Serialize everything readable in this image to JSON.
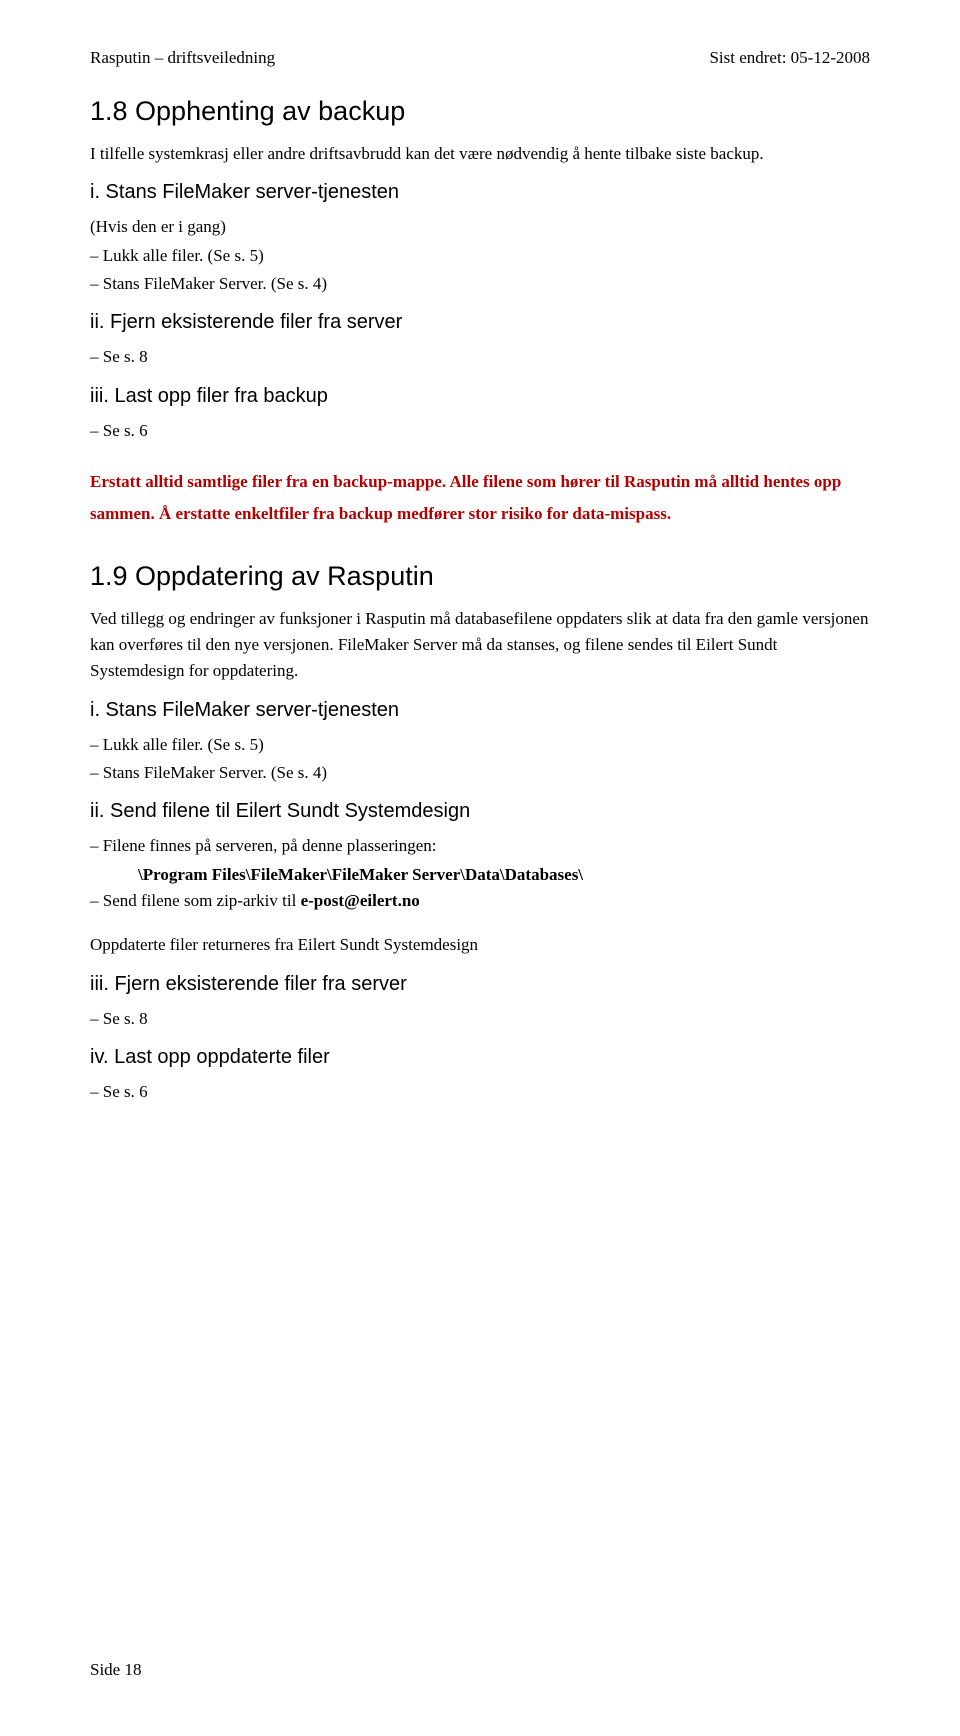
{
  "header": {
    "left": "Rasputin – driftsveiledning",
    "right": "Sist endret: 05-12-2008"
  },
  "s18": {
    "title": "1.8   Opphenting av backup",
    "intro": "I tilfelle systemkrasj eller andre driftsavbrudd kan det være nødvendig å hente tilbake siste backup.",
    "i_title": "i. Stans FileMaker server-tjenesten",
    "i_note": "(Hvis den er i gang)",
    "i_step1": "– Lukk alle filer. (Se s. 5)",
    "i_step2": "– Stans FileMaker Server. (Se s. 4)",
    "ii_title": "ii. Fjern eksisterende filer fra server",
    "ii_step1": "– Se s. 8",
    "iii_title": "iii. Last opp filer fra backup",
    "iii_step1": "– Se s. 6",
    "warning": "Erstatt alltid samtlige filer fra en backup-mappe. Alle filene som hører til Rasputin må alltid hentes opp sammen. Å erstatte enkeltfiler fra backup medfører stor risiko for data-mispass."
  },
  "s19": {
    "title": "1.9   Oppdatering av Rasputin",
    "intro": "Ved tillegg og endringer av funksjoner i Rasputin må databasefilene oppdaters slik at data fra den gamle versjonen kan overføres til den nye versjonen. FileMaker Server må da stanses, og filene sendes til Eilert Sundt Systemdesign for oppdatering.",
    "i_title": "i. Stans FileMaker server-tjenesten",
    "i_step1": "– Lukk alle filer. (Se s. 5)",
    "i_step2": "– Stans FileMaker Server. (Se s. 4)",
    "ii_title": "ii. Send filene til Eilert Sundt Systemdesign",
    "ii_step1": "– Filene finnes på serveren, på denne plasseringen:",
    "ii_path": "\\Program Files\\FileMaker\\FileMaker Server\\Data\\Databases\\",
    "ii_step2_pre": "– Send filene som zip-arkiv til ",
    "ii_step2_bold": "e-post@eilert.no",
    "mid_note": "Oppdaterte filer returneres fra Eilert Sundt Systemdesign",
    "iii_title": "iii. Fjern eksisterende filer fra server",
    "iii_step1": "– Se s. 8",
    "iv_title": "iv. Last opp oppdaterte filer",
    "iv_step1": "– Se s. 6"
  },
  "footer": "Side 18"
}
